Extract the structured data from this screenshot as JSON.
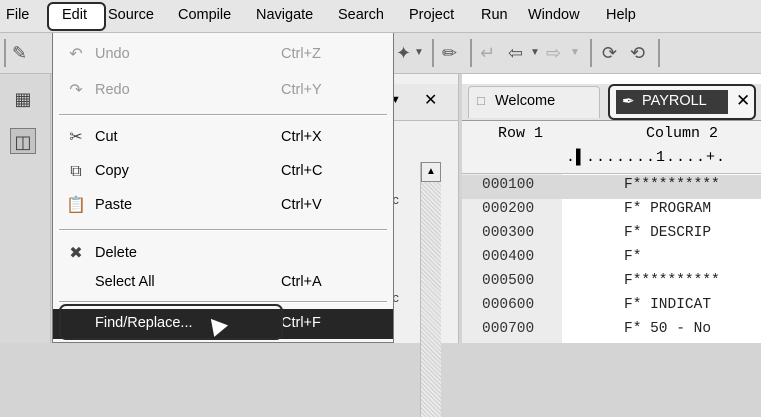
{
  "menubar": [
    "File",
    "Edit",
    "Source",
    "Compile",
    "Navigate",
    "Search",
    "Project",
    "Run",
    "Window",
    "Help"
  ],
  "edit_menu": {
    "undo": {
      "label": "Undo",
      "shortcut": "Ctrl+Z"
    },
    "redo": {
      "label": "Redo",
      "shortcut": "Ctrl+Y"
    },
    "cut": {
      "label": "Cut",
      "shortcut": "Ctrl+X"
    },
    "copy": {
      "label": "Copy",
      "shortcut": "Ctrl+C"
    },
    "paste": {
      "label": "Paste",
      "shortcut": "Ctrl+V"
    },
    "delete": {
      "label": "Delete",
      "shortcut": ""
    },
    "select_all": {
      "label": "Select All",
      "shortcut": "Ctrl+A"
    },
    "find_replace": {
      "label": "Find/Replace...",
      "shortcut": "Ctrl+F"
    }
  },
  "left_view": {
    "text_a": "rc",
    "text_b": "rc"
  },
  "editor": {
    "tabs": {
      "welcome": "Welcome",
      "payroll": "PAYROLL"
    },
    "ruler_row": "Row 1",
    "ruler_col": "Column 2",
    "ruler_marks": ".▌.......1....+.",
    "lines": [
      {
        "seq": "000100",
        "src": "F**********"
      },
      {
        "seq": "000200",
        "src": "F*  PROGRAM"
      },
      {
        "seq": "000300",
        "src": "F*  DESCRIP"
      },
      {
        "seq": "000400",
        "src": "F*"
      },
      {
        "seq": "000500",
        "src": "F**********"
      },
      {
        "seq": "000600",
        "src": "F*  INDICAT"
      },
      {
        "seq": "000700",
        "src": "F*  50 - No"
      }
    ]
  }
}
